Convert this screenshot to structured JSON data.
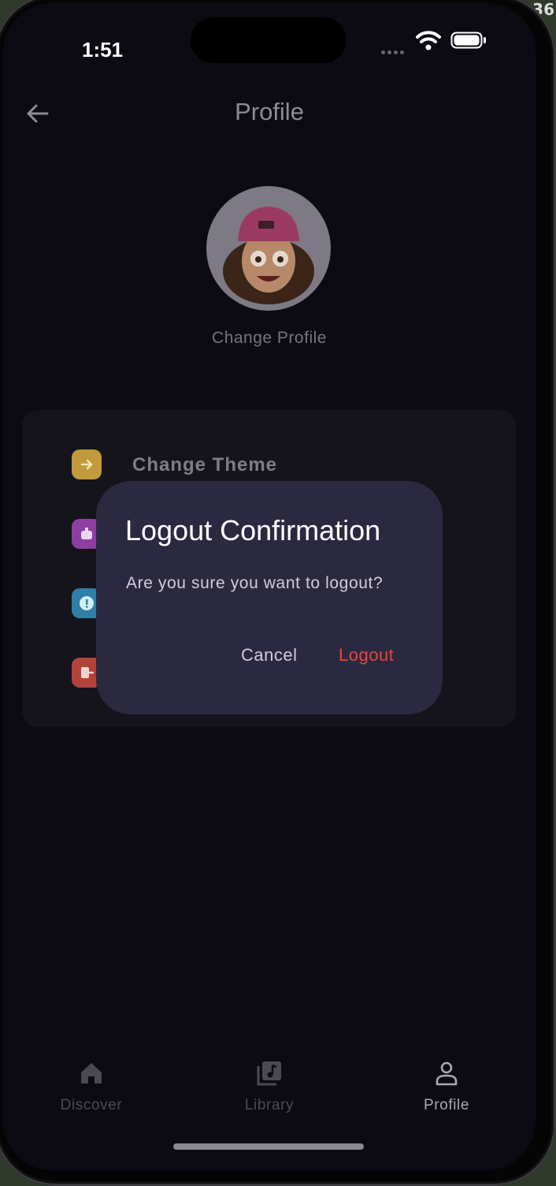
{
  "status": {
    "time": "1:51"
  },
  "header": {
    "title": "Profile",
    "back_icon": "back-arrow-icon"
  },
  "profile": {
    "change_label": "Change Profile"
  },
  "options": [
    {
      "label": "Change Theme",
      "color": "#c19a3c",
      "icon": "arrow-icon"
    },
    {
      "label": "",
      "color": "#8e3ea0",
      "icon": "robot-icon"
    },
    {
      "label": "",
      "color": "#2f7fa8",
      "icon": "info-icon"
    },
    {
      "label": "",
      "color": "#b2433a",
      "icon": "logout-icon"
    }
  ],
  "dialog": {
    "title": "Logout Confirmation",
    "message": "Are you sure you want to logout?",
    "cancel": "Cancel",
    "confirm": "Logout",
    "confirm_color": "#e8463c"
  },
  "nav": [
    {
      "label": "Discover",
      "icon": "home-icon"
    },
    {
      "label": "Library",
      "icon": "library-icon"
    },
    {
      "label": "Profile",
      "icon": "person-icon",
      "active": true
    }
  ]
}
